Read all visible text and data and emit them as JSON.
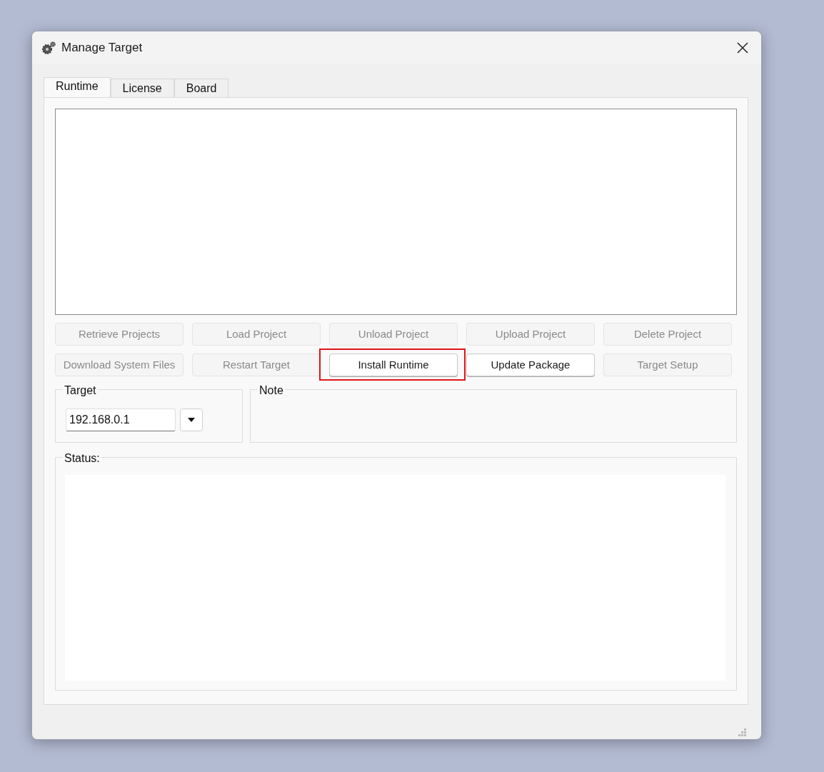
{
  "window": {
    "title": "Manage Target"
  },
  "tabs": [
    {
      "label": "Runtime",
      "selected": true
    },
    {
      "label": "License",
      "selected": false
    },
    {
      "label": "Board",
      "selected": false
    }
  ],
  "buttons": [
    {
      "label": "Retrieve Projects",
      "disabled": true,
      "highlighted": false
    },
    {
      "label": "Load Project",
      "disabled": true,
      "highlighted": false
    },
    {
      "label": "Unload Project",
      "disabled": true,
      "highlighted": false
    },
    {
      "label": "Upload Project",
      "disabled": true,
      "highlighted": false
    },
    {
      "label": "Delete Project",
      "disabled": true,
      "highlighted": false
    },
    {
      "label": "Download System Files",
      "disabled": true,
      "highlighted": false
    },
    {
      "label": "Restart Target",
      "disabled": true,
      "highlighted": false
    },
    {
      "label": "Install Runtime",
      "disabled": false,
      "highlighted": true
    },
    {
      "label": "Update Package",
      "disabled": false,
      "highlighted": false
    },
    {
      "label": "Target Setup",
      "disabled": true,
      "highlighted": false
    }
  ],
  "target_group": {
    "title": "Target",
    "value": "192.168.0.1"
  },
  "note_group": {
    "title": "Note"
  },
  "status_group": {
    "title": "Status:"
  }
}
